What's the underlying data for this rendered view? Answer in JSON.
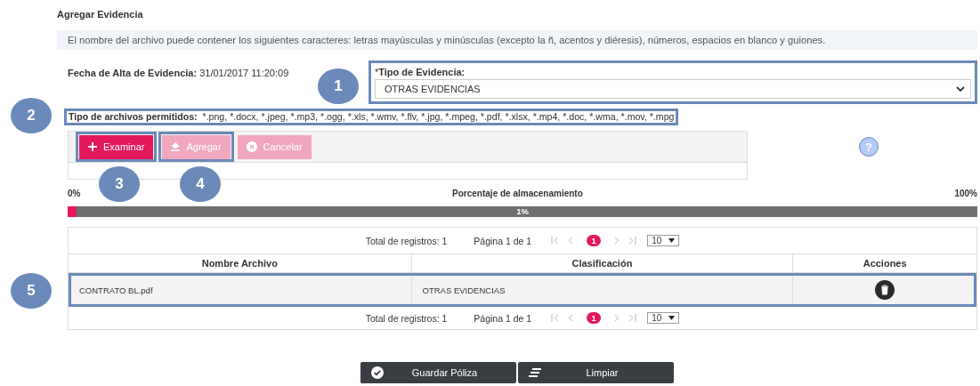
{
  "title": "Agregar Evidencia",
  "notice": "El nombre del archivo puede contener los siguientes caracteres: letras mayúsculas y minúsculas (excepto la ñ, acentos y diéresis), números, espacios en blanco y guiones.",
  "fecha": {
    "label": "Fecha de Alta de Evidencia:",
    "value": "31/01/2017 11:20:09"
  },
  "tipo_evidencia": {
    "required_mark": "*",
    "label": "Tipo de Evidencia:",
    "value": "OTRAS EVIDENCIAS"
  },
  "allowed_types": {
    "label": "Tipo de archivos permitidos:",
    "value": "*.png, *.docx, *.jpeg, *.mp3, *.ogg, *.xls, *.wmv, *.flv, *.jpg, *.mpeg, *.pdf, *.xlsx, *.mp4, *.doc, *.wma, *.mov, *.mpg"
  },
  "upload_buttons": [
    {
      "kind": "browse",
      "label": "Examinar",
      "disabled": false
    },
    {
      "kind": "upload",
      "label": "Agregar",
      "disabled": true
    },
    {
      "kind": "cancel",
      "label": "Cancelar",
      "disabled": true
    }
  ],
  "progress": {
    "min_label": "0%",
    "title": "Porcentaje de almacenamiento",
    "max_label": "100%",
    "level": 0.01,
    "reading": "1%"
  },
  "table": {
    "pagination_top": {
      "total": "Total de registros: 1",
      "page": "Página 1 de 1",
      "current": "1",
      "page_size": "10"
    },
    "columns": [
      "Nombre Archivo",
      "Clasificación",
      "Acciones"
    ],
    "rows": [
      {
        "name": "CONTRATO BL.pdf",
        "classification": "OTRAS EVIDENCIAS"
      }
    ],
    "pagination_bottom": {
      "total": "Total de registros: 1",
      "page": "Página 1 de 1",
      "current": "1",
      "page_size": "10"
    }
  },
  "footer_buttons": [
    {
      "kind": "save",
      "label": "Guardar Póliza"
    },
    {
      "kind": "clear",
      "label": "Limpiar"
    }
  ],
  "help_icon": "?",
  "callouts": [
    "1",
    "2",
    "3",
    "4",
    "5"
  ]
}
